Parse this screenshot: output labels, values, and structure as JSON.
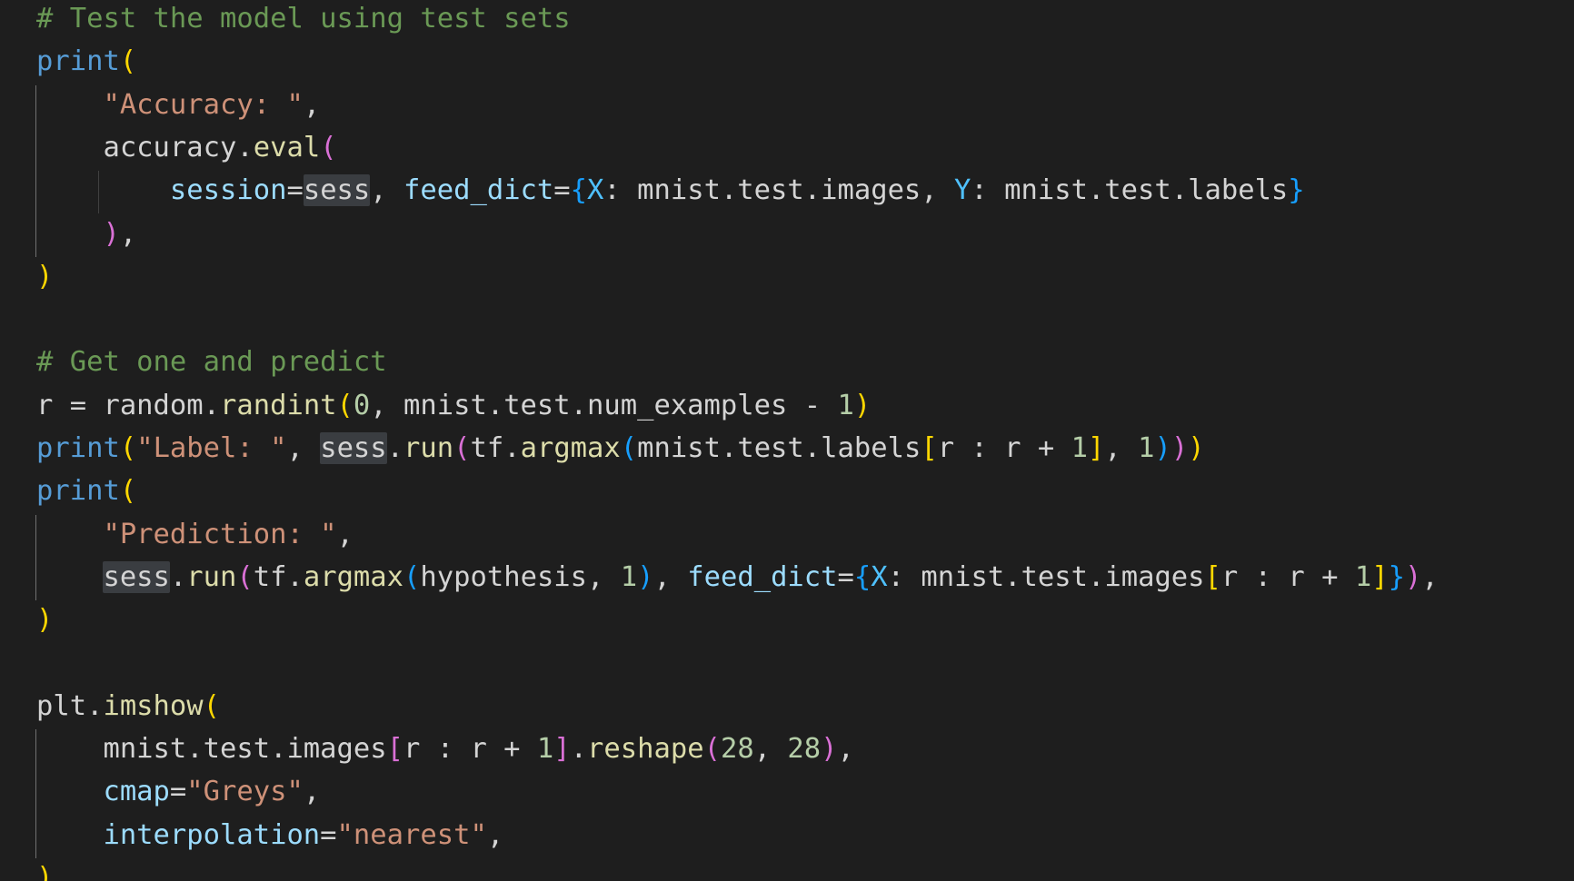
{
  "editor": {
    "language": "python",
    "theme_colors": {
      "background": "#1e1e1e",
      "comment": "#6a9955",
      "function": "#dcdcaa",
      "keyword_builtin": "#569cd6",
      "variable": "#9cdcfe",
      "string": "#ce9178",
      "number": "#b5cea8",
      "bracket_level_1": "#ffd700",
      "bracket_level_2": "#da70d6",
      "bracket_level_3": "#179fff",
      "word_highlight": "#3a3d41"
    },
    "lines": [
      [
        {
          "t": "# Test the model using test sets",
          "c": "t-comment"
        }
      ],
      [
        {
          "t": "print",
          "c": "t-builtin"
        },
        {
          "t": "(",
          "c": "b1"
        }
      ],
      [
        {
          "t": "    "
        },
        {
          "t": "\"Accuracy: \"",
          "c": "t-str"
        },
        {
          "t": ","
        }
      ],
      [
        {
          "t": "    "
        },
        {
          "t": "accuracy"
        },
        {
          "t": "."
        },
        {
          "t": "eval",
          "c": "t-func"
        },
        {
          "t": "(",
          "c": "b2"
        }
      ],
      [
        {
          "t": "        "
        },
        {
          "t": "session",
          "c": "t-var"
        },
        {
          "t": "="
        },
        {
          "t": "sess",
          "c": "hl"
        },
        {
          "t": ", "
        },
        {
          "t": "feed_dict",
          "c": "t-var"
        },
        {
          "t": "="
        },
        {
          "t": "{",
          "c": "b3"
        },
        {
          "t": "X",
          "c": "t-const"
        },
        {
          "t": ": mnist.test.images, "
        },
        {
          "t": "Y",
          "c": "t-const"
        },
        {
          "t": ": mnist.test.labels"
        },
        {
          "t": "}",
          "c": "b3"
        }
      ],
      [
        {
          "t": "    "
        },
        {
          "t": ")",
          "c": "b2"
        },
        {
          "t": ","
        }
      ],
      [
        {
          "t": ")",
          "c": "b1"
        }
      ],
      [],
      [
        {
          "t": "# Get one and predict",
          "c": "t-comment"
        }
      ],
      [
        {
          "t": "r = random."
        },
        {
          "t": "randint",
          "c": "t-func"
        },
        {
          "t": "(",
          "c": "b1"
        },
        {
          "t": "0",
          "c": "t-num"
        },
        {
          "t": ", mnist.test.num_examples - "
        },
        {
          "t": "1",
          "c": "t-num"
        },
        {
          "t": ")",
          "c": "b1"
        }
      ],
      [
        {
          "t": "print",
          "c": "t-builtin"
        },
        {
          "t": "(",
          "c": "b1"
        },
        {
          "t": "\"Label: \"",
          "c": "t-str"
        },
        {
          "t": ", "
        },
        {
          "t": "sess",
          "c": "hl"
        },
        {
          "t": "."
        },
        {
          "t": "run",
          "c": "t-func"
        },
        {
          "t": "(",
          "c": "b2"
        },
        {
          "t": "tf."
        },
        {
          "t": "argmax",
          "c": "t-func"
        },
        {
          "t": "(",
          "c": "b3"
        },
        {
          "t": "mnist.test.labels"
        },
        {
          "t": "[",
          "c": "b1"
        },
        {
          "t": "r : r + "
        },
        {
          "t": "1",
          "c": "t-num"
        },
        {
          "t": "]",
          "c": "b1"
        },
        {
          "t": ", "
        },
        {
          "t": "1",
          "c": "t-num"
        },
        {
          "t": ")",
          "c": "b3"
        },
        {
          "t": ")",
          "c": "b2"
        },
        {
          "t": ")",
          "c": "b1"
        }
      ],
      [
        {
          "t": "print",
          "c": "t-builtin"
        },
        {
          "t": "(",
          "c": "b1"
        }
      ],
      [
        {
          "t": "    "
        },
        {
          "t": "\"Prediction: \"",
          "c": "t-str"
        },
        {
          "t": ","
        }
      ],
      [
        {
          "t": "    "
        },
        {
          "t": "sess",
          "c": "hl"
        },
        {
          "t": "."
        },
        {
          "t": "run",
          "c": "t-func"
        },
        {
          "t": "(",
          "c": "b2"
        },
        {
          "t": "tf."
        },
        {
          "t": "argmax",
          "c": "t-func"
        },
        {
          "t": "(",
          "c": "b3"
        },
        {
          "t": "hypothesis, "
        },
        {
          "t": "1",
          "c": "t-num"
        },
        {
          "t": ")",
          "c": "b3"
        },
        {
          "t": ", "
        },
        {
          "t": "feed_dict",
          "c": "t-var"
        },
        {
          "t": "="
        },
        {
          "t": "{",
          "c": "b3"
        },
        {
          "t": "X",
          "c": "t-const"
        },
        {
          "t": ": mnist.test.images"
        },
        {
          "t": "[",
          "c": "b1"
        },
        {
          "t": "r : r + "
        },
        {
          "t": "1",
          "c": "t-num"
        },
        {
          "t": "]",
          "c": "b1"
        },
        {
          "t": "}",
          "c": "b3"
        },
        {
          "t": ")",
          "c": "b2"
        },
        {
          "t": ","
        }
      ],
      [
        {
          "t": ")",
          "c": "b1"
        }
      ],
      [],
      [
        {
          "t": "plt."
        },
        {
          "t": "imshow",
          "c": "t-func"
        },
        {
          "t": "(",
          "c": "b1"
        }
      ],
      [
        {
          "t": "    "
        },
        {
          "t": "mnist.test.images"
        },
        {
          "t": "[",
          "c": "b2"
        },
        {
          "t": "r : r + "
        },
        {
          "t": "1",
          "c": "t-num"
        },
        {
          "t": "]",
          "c": "b2"
        },
        {
          "t": "."
        },
        {
          "t": "reshape",
          "c": "t-func"
        },
        {
          "t": "(",
          "c": "b2"
        },
        {
          "t": "28",
          "c": "t-num"
        },
        {
          "t": ", "
        },
        {
          "t": "28",
          "c": "t-num"
        },
        {
          "t": ")",
          "c": "b2"
        },
        {
          "t": ","
        }
      ],
      [
        {
          "t": "    "
        },
        {
          "t": "cmap",
          "c": "t-var"
        },
        {
          "t": "="
        },
        {
          "t": "\"Greys\"",
          "c": "t-str"
        },
        {
          "t": ","
        }
      ],
      [
        {
          "t": "    "
        },
        {
          "t": "interpolation",
          "c": "t-var"
        },
        {
          "t": "="
        },
        {
          "t": "\"nearest\"",
          "c": "t-str"
        },
        {
          "t": ","
        }
      ],
      [
        {
          "t": ")",
          "c": "b1"
        }
      ]
    ]
  }
}
